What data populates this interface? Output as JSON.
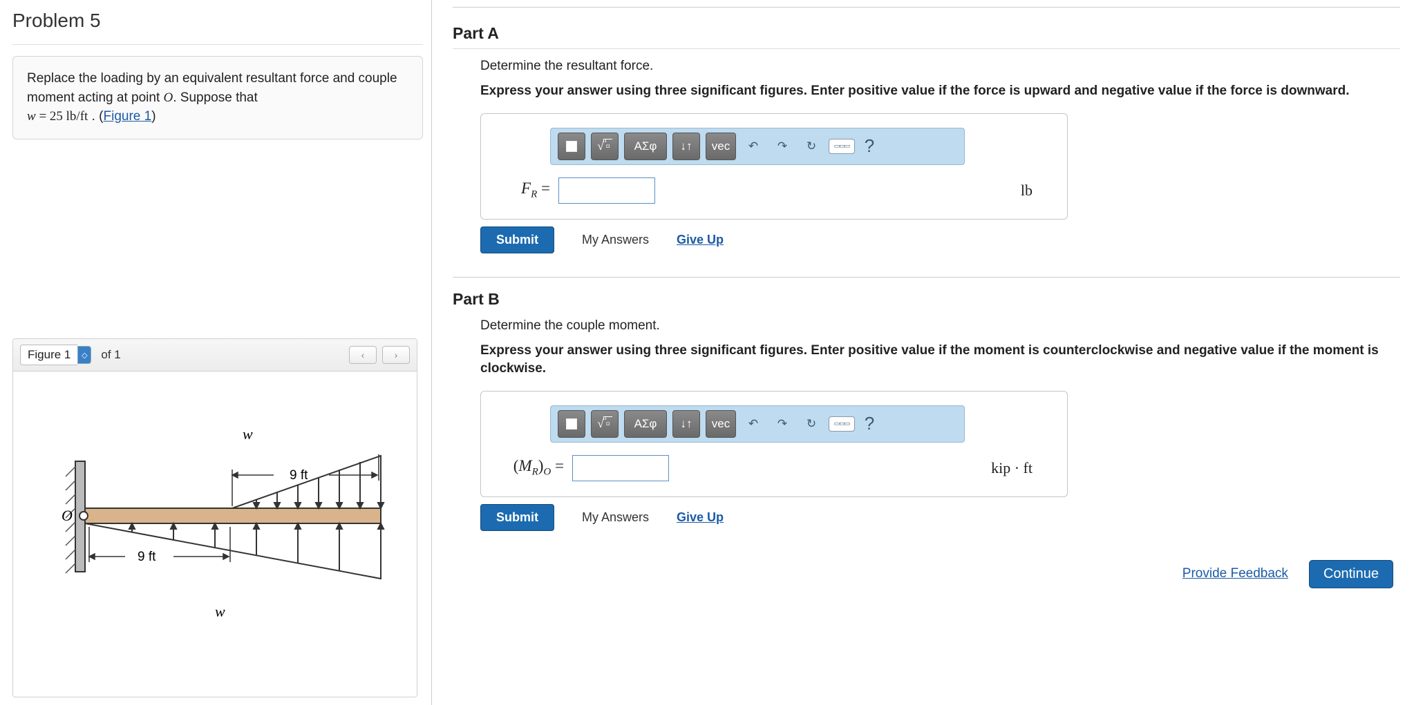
{
  "problem": {
    "title": "Problem 5",
    "statement_1": "Replace the loading by an equivalent resultant force and couple moment acting at point ",
    "point_var": "O",
    "statement_2": ". Suppose that",
    "equation_var": "w",
    "equation_val": " = 25  lb/ft",
    "statement_3": " . (",
    "figure_link": "Figure 1",
    "statement_4": ")"
  },
  "figure": {
    "label": "Figure 1",
    "counter": "of 1",
    "prev": "‹",
    "next": "›",
    "diagram": {
      "w_top": "w",
      "w_bottom": "w",
      "dim_top": "9 ft",
      "dim_bottom": "9 ft",
      "origin": "O"
    }
  },
  "partA": {
    "title": "Part A",
    "question": "Determine the resultant force.",
    "instruction": "Express your answer using three significant figures. Enter positive value if the force is upward and negative value if the force is downward.",
    "eq_label_base": "F",
    "eq_label_sub": "R",
    "eq_equals": " = ",
    "unit": "lb",
    "submit": "Submit",
    "myanswers": "My Answers",
    "giveup": "Give Up"
  },
  "partB": {
    "title": "Part B",
    "question": "Determine the couple moment.",
    "instruction": "Express your answer using three significant figures. Enter positive value if the moment is counterclockwise and negative value if the moment is clockwise.",
    "eq_label_open": "(",
    "eq_label_base": "M",
    "eq_label_sub": "R",
    "eq_label_close": ")",
    "eq_label_outer": "O",
    "eq_equals": " = ",
    "unit": "kip · ft",
    "submit": "Submit",
    "myanswers": "My Answers",
    "giveup": "Give Up"
  },
  "toolbar": {
    "templates": "▮",
    "root": "ⁿ√▢",
    "greek": "ΑΣφ",
    "arrows": "↓↑",
    "vec": "vec",
    "undo": "↶",
    "redo": "↷",
    "reset": "↻",
    "keyboard": "⌨",
    "help": "?"
  },
  "footer": {
    "feedback": "Provide Feedback",
    "continue": "Continue"
  }
}
